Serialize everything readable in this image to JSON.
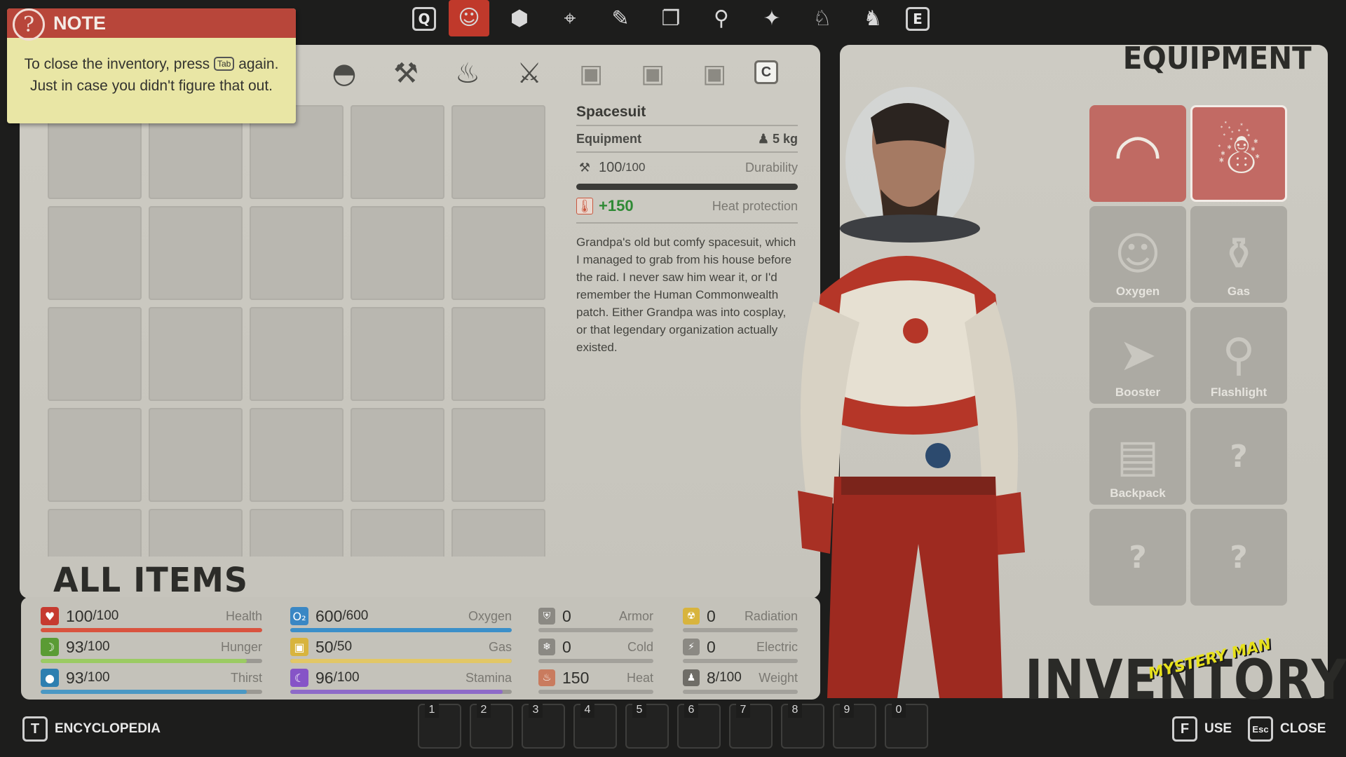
{
  "nav": {
    "left_key": "Q",
    "right_key": "E",
    "icons": [
      "character-icon",
      "crafting-icon",
      "map-icon",
      "quests-icon",
      "journal-icon",
      "discoveries-icon",
      "achievements-icon",
      "collectibles-icon",
      "bestiary-icon"
    ]
  },
  "note": {
    "title": "NOTE",
    "icon": "question-icon",
    "text_before": "To close the inventory, press",
    "key": "Tab",
    "text_after": "again. Just in case you didn't figure that out."
  },
  "categories": {
    "icons": [
      "resources-icon",
      "parts-icon",
      "tools-icon",
      "ducks-icon",
      "shovel-icon",
      "lock-icon",
      "lock-icon",
      "lock-icon"
    ],
    "next_key": "C"
  },
  "item": {
    "name": "Spacesuit",
    "type": "Equipment",
    "weight": "5 kg",
    "durability_value": "100",
    "durability_max": "/100",
    "durability_label": "Durability",
    "durability_fraction": 1.0,
    "heat_value": "+150",
    "heat_label": "Heat protection",
    "description": "Grandpa's old but comfy spacesuit, which I managed to grab from his house before the raid. I never saw him wear it, or I'd remember the Human Commonwealth patch. Either Grandpa was into cosplay, or that legendary organization actually existed."
  },
  "all_items_label": "ALL ITEMS",
  "stats": [
    {
      "value": "100",
      "max": "/100",
      "label": "Health",
      "fraction": 1.0,
      "color": "#d9533f",
      "icon_color": "#c63a30"
    },
    {
      "value": "93",
      "max": "/100",
      "label": "Hunger",
      "fraction": 0.93,
      "color": "#9bcb63",
      "icon_color": "#5a9b34"
    },
    {
      "value": "93",
      "max": "/100",
      "label": "Thirst",
      "fraction": 0.93,
      "color": "#4a98c4",
      "icon_color": "#2d7fb0"
    },
    {
      "value": "600",
      "max": "/600",
      "label": "Oxygen",
      "fraction": 1.0,
      "color": "#3b8fc9",
      "icon_color": "#3a87c4"
    },
    {
      "value": "50",
      "max": "/50",
      "label": "Gas",
      "fraction": 1.0,
      "color": "#e2c766",
      "icon_color": "#d8b43d"
    },
    {
      "value": "96",
      "max": "/100",
      "label": "Stamina",
      "fraction": 0.96,
      "color": "#8e6ac8",
      "icon_color": "#8654c7"
    }
  ],
  "defences": [
    {
      "value": "0",
      "max": "",
      "label": "Armor",
      "icon_color": "#8b8983"
    },
    {
      "value": "0",
      "max": "",
      "label": "Cold",
      "icon_color": "#8b8983"
    },
    {
      "value": "150",
      "max": "",
      "label": "Heat",
      "icon_color": "#c97b5e"
    },
    {
      "value": "0",
      "max": "",
      "label": "Radiation",
      "icon_color": "#d8b43d"
    },
    {
      "value": "0",
      "max": "",
      "label": "Electric",
      "icon_color": "#8b8983"
    },
    {
      "value": "8",
      "max": "/100",
      "label": "Weight",
      "icon_color": "#6f6d67"
    }
  ],
  "equipment": {
    "title": "EQUIPMENT",
    "slots": [
      {
        "label": "",
        "filled": true,
        "icon": "helmet-icon"
      },
      {
        "label": "",
        "filled": true,
        "icon": "spacesuit-icon"
      },
      {
        "label": "Oxygen",
        "filled": false,
        "icon": "oxygen-tank-icon"
      },
      {
        "label": "Gas",
        "filled": false,
        "icon": "gas-canister-icon"
      },
      {
        "label": "Booster",
        "filled": false,
        "icon": "booster-icon"
      },
      {
        "label": "Flashlight",
        "filled": false,
        "icon": "flashlight-icon"
      },
      {
        "label": "Backpack",
        "filled": false,
        "icon": "backpack-icon"
      },
      {
        "label": "?",
        "filled": false,
        "icon": "unknown-icon"
      },
      {
        "label": "?",
        "filled": false,
        "icon": "unknown-icon"
      },
      {
        "label": "?",
        "filled": false,
        "icon": "unknown-icon"
      }
    ]
  },
  "inventory_label": "INVENTORY",
  "logo_text": "MYSTERY MAN",
  "hotbar": [
    "1",
    "2",
    "3",
    "4",
    "5",
    "6",
    "7",
    "8",
    "9",
    "0"
  ],
  "bottom": {
    "encyclopedia_key": "T",
    "encyclopedia_label": "ENCYCLOPEDIA",
    "use_key": "F",
    "use_label": "USE",
    "close_key": "Esc",
    "close_label": "CLOSE"
  }
}
